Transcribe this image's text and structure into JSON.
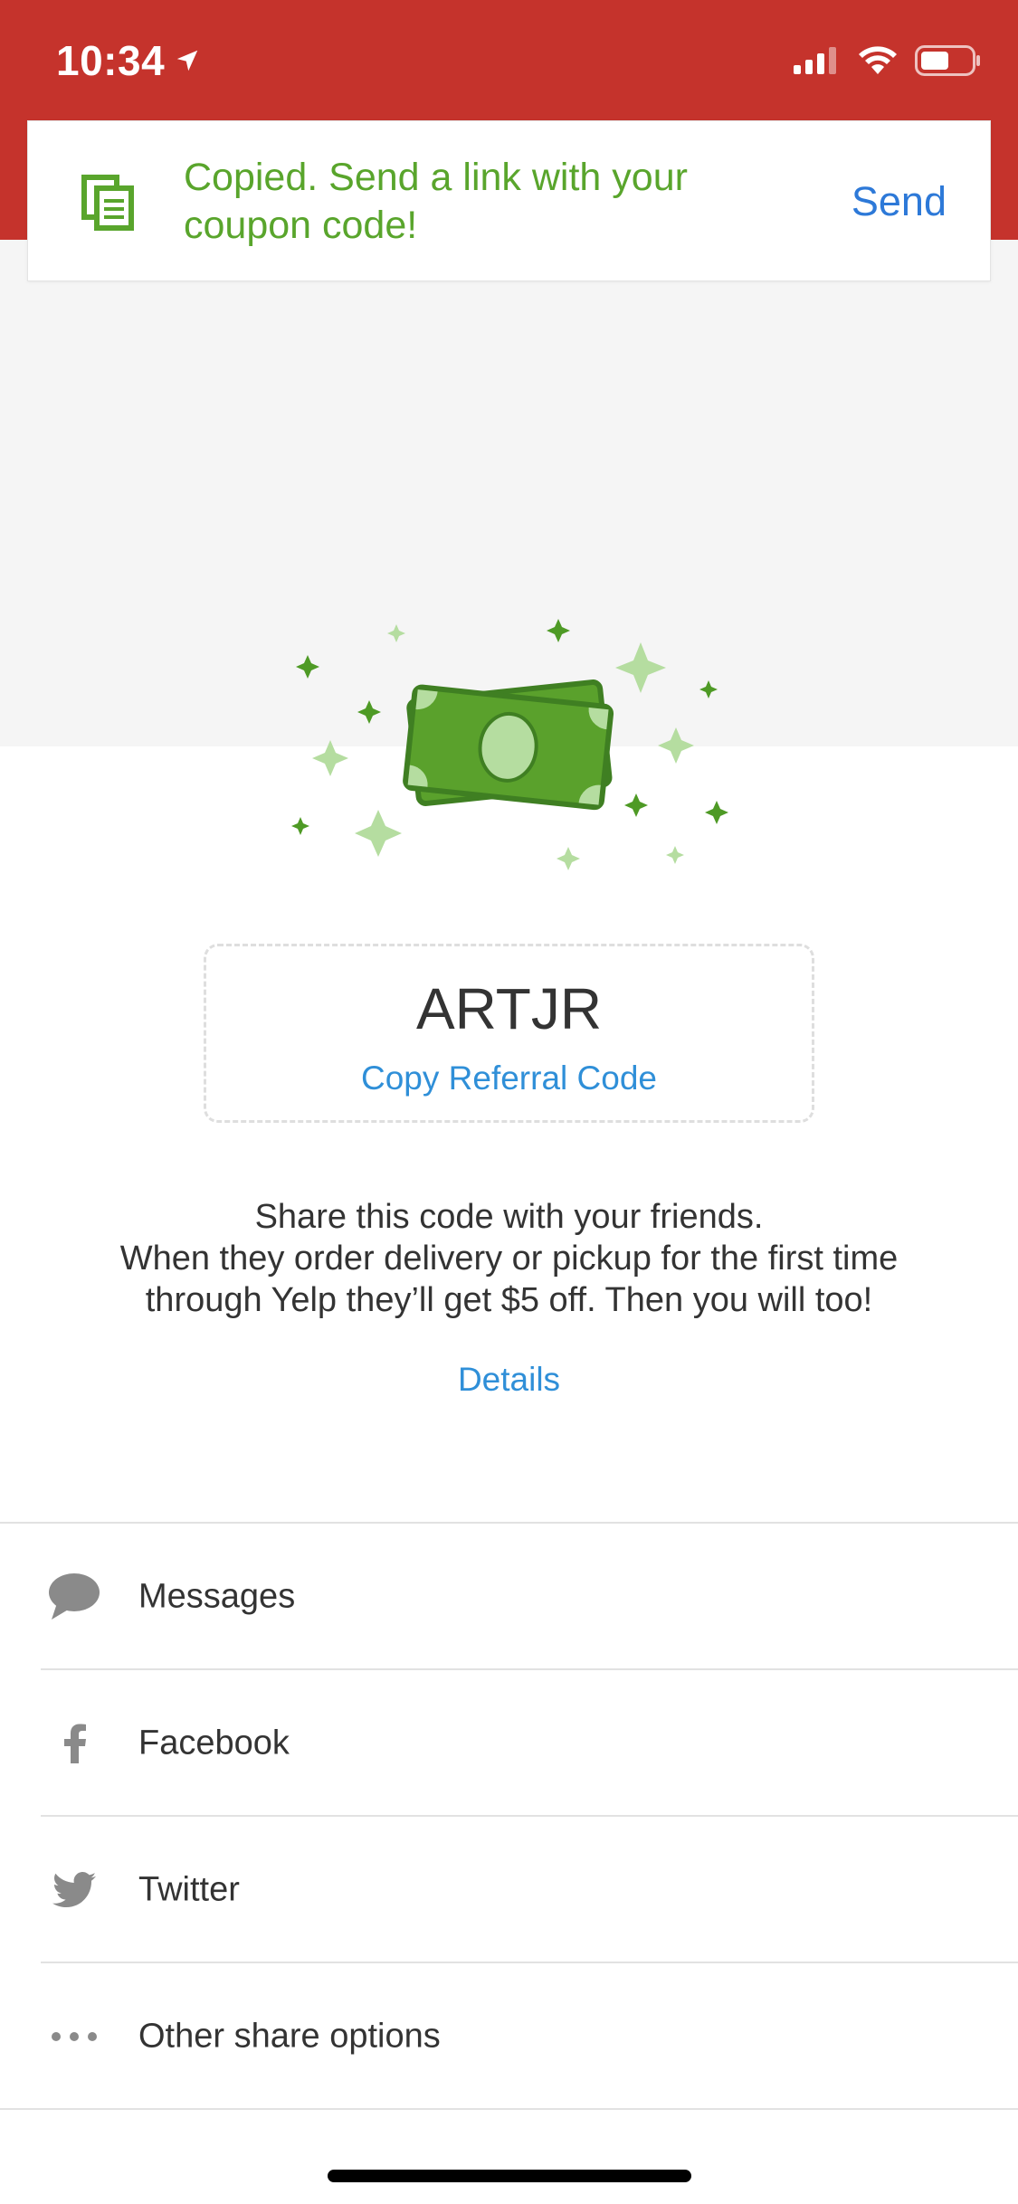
{
  "status_bar": {
    "time": "10:34",
    "icons": [
      "location-arrow-icon",
      "cellular-signal-icon",
      "wifi-icon",
      "battery-icon"
    ]
  },
  "toast": {
    "icon": "copy-document-icon",
    "message": "Copied. Send a link with your coupon code!",
    "send_label": "Send"
  },
  "referral": {
    "illustration": "money-bills-sparkles-illustration",
    "code": "ARTJR",
    "copy_label": "Copy Referral Code",
    "line1": "Share this code with your friends.",
    "line2": "When they order delivery or pickup for the first time",
    "line3": "through Yelp they’ll get $5 off. Then you will too!",
    "details_label": "Details"
  },
  "share_options": [
    {
      "label": "Messages",
      "icon": "message-bubble-icon"
    },
    {
      "label": "Facebook",
      "icon": "facebook-icon"
    },
    {
      "label": "Twitter",
      "icon": "twitter-bird-icon"
    },
    {
      "label": "Other share options",
      "icon": "more-dots-icon"
    }
  ],
  "colors": {
    "header_red": "#c5332c",
    "success_green": "#59a52c",
    "link_blue": "#2f8fd8",
    "send_blue": "#2d79d8"
  }
}
